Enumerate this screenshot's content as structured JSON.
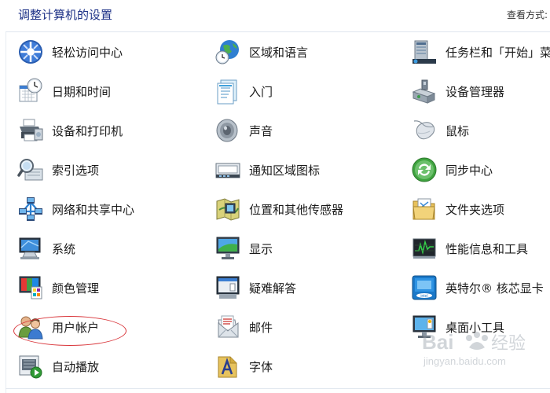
{
  "header": {
    "title": "调整计算机的设置",
    "view_by": "查看方式:"
  },
  "items": [
    {
      "label": "轻松访问中心",
      "icon": "ease-of-access-icon"
    },
    {
      "label": "区域和语言",
      "icon": "region-globe-icon"
    },
    {
      "label": "任务栏和「开始」菜",
      "icon": "taskbar-start-menu-icon"
    },
    {
      "label": "日期和时间",
      "icon": "date-time-clock-icon"
    },
    {
      "label": "入门",
      "icon": "getting-started-icon"
    },
    {
      "label": "设备管理器",
      "icon": "device-manager-icon"
    },
    {
      "label": "设备和打印机",
      "icon": "devices-printers-icon"
    },
    {
      "label": "声音",
      "icon": "sound-speaker-icon"
    },
    {
      "label": "鼠标",
      "icon": "mouse-icon"
    },
    {
      "label": "索引选项",
      "icon": "indexing-magnifier-icon"
    },
    {
      "label": "通知区域图标",
      "icon": "notification-area-icon"
    },
    {
      "label": "同步中心",
      "icon": "sync-center-icon"
    },
    {
      "label": "网络和共享中心",
      "icon": "network-sharing-icon"
    },
    {
      "label": "位置和其他传感器",
      "icon": "location-sensors-icon"
    },
    {
      "label": "文件夹选项",
      "icon": "folder-options-icon"
    },
    {
      "label": "系统",
      "icon": "system-computer-icon"
    },
    {
      "label": "显示",
      "icon": "display-monitor-icon"
    },
    {
      "label": "性能信息和工具",
      "icon": "performance-tools-icon"
    },
    {
      "label": "颜色管理",
      "icon": "color-management-icon"
    },
    {
      "label": "疑难解答",
      "icon": "troubleshooting-icon"
    },
    {
      "label": "英特尔® 核芯显卡",
      "icon": "intel-graphics-icon"
    },
    {
      "label": "用户帐户",
      "icon": "user-accounts-icon"
    },
    {
      "label": "邮件",
      "icon": "mail-icon"
    },
    {
      "label": "桌面小工具",
      "icon": "desktop-gadgets-icon"
    },
    {
      "label": "自动播放",
      "icon": "autoplay-icon"
    },
    {
      "label": "字体",
      "icon": "fonts-icon"
    }
  ],
  "colors": {
    "title": "#1e3287",
    "label": "#1a1a1a",
    "highlight": "#d9353a"
  },
  "watermark": {
    "brand": "Bai",
    "brand_suffix": "经验",
    "url": "jingyan.baidu.com"
  }
}
